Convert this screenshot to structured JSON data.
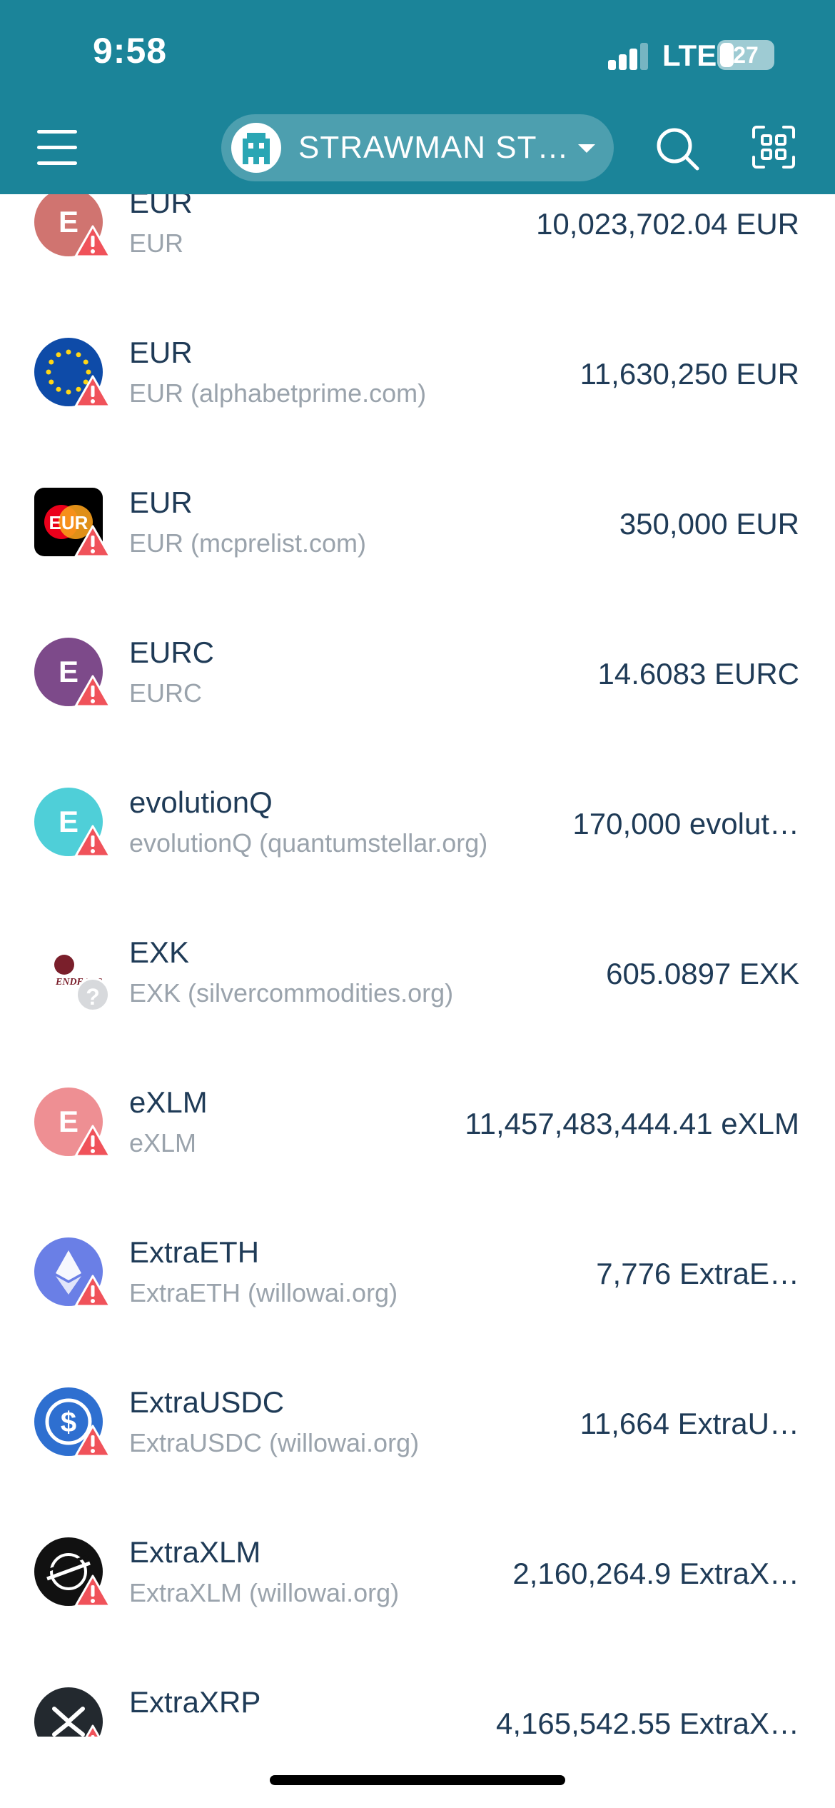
{
  "status_bar": {
    "time": "9:58",
    "network": "LTE",
    "battery": "27",
    "battery_level": 0.27
  },
  "header": {
    "account_name": "STRAWMAN ST…",
    "menu_icon": "menu-icon",
    "search_icon": "search-icon",
    "scan_icon": "qr-scan-icon"
  },
  "colors": {
    "header_bg": "#1b8499",
    "text_primary": "#1f3b57",
    "text_secondary": "#9aa3ac",
    "warning": "#f0525a"
  },
  "assets": [
    {
      "letter": "E",
      "code": "EUR",
      "domain": "EUR",
      "balance": "10,023,702.04 EUR",
      "icon": "letter-avatar",
      "color": "#d07470",
      "flag": "warning"
    },
    {
      "letter": "",
      "code": "EUR",
      "domain": "EUR (alphabetprime.com)",
      "balance": "11,630,250 EUR",
      "icon": "eu-flag-icon",
      "color": "#0e4ba8",
      "flag": "warning"
    },
    {
      "letter": "EUR",
      "code": "EUR",
      "domain": "EUR (mcprelist.com)",
      "balance": "350,000 EUR",
      "icon": "mastercard-eur-icon",
      "color": "#000000",
      "flag": "warning"
    },
    {
      "letter": "E",
      "code": "EURC",
      "domain": "EURC",
      "balance": "14.6083 EURC",
      "icon": "letter-avatar",
      "color": "#7d4a8a",
      "flag": "warning"
    },
    {
      "letter": "E",
      "code": "evolutionQ",
      "domain": "evolutionQ (quantumstellar.org)",
      "balance": "170,000 evolut…",
      "icon": "letter-avatar",
      "color": "#4fcfd8",
      "flag": "warning"
    },
    {
      "letter": "ENDEAVO",
      "code": "EXK",
      "domain": "EXK (silvercommodities.org)",
      "balance": "605.0897 EXK",
      "icon": "endeavour-logo-icon",
      "color": "#ffffff",
      "flag": "unknown"
    },
    {
      "letter": "E",
      "code": "eXLM",
      "domain": "eXLM",
      "balance": "11,457,483,444.41 eXLM",
      "icon": "letter-avatar",
      "color": "#ee8f93",
      "flag": "warning"
    },
    {
      "letter": "",
      "code": "ExtraETH",
      "domain": "ExtraETH (willowai.org)",
      "balance": "7,776 ExtraE…",
      "icon": "ethereum-icon",
      "color": "#6a7fe6",
      "flag": "warning"
    },
    {
      "letter": "",
      "code": "ExtraUSDC",
      "domain": "ExtraUSDC (willowai.org)",
      "balance": "11,664 ExtraU…",
      "icon": "usdc-icon",
      "color": "#2e6fd0",
      "flag": "warning"
    },
    {
      "letter": "",
      "code": "ExtraXLM",
      "domain": "ExtraXLM (willowai.org)",
      "balance": "2,160,264.9 ExtraX…",
      "icon": "stellar-icon",
      "color": "#111111",
      "flag": "warning"
    },
    {
      "letter": "",
      "code": "ExtraXRP",
      "domain": "",
      "balance": "4,165,542.55 ExtraX…",
      "icon": "xrp-icon",
      "color": "#23292f",
      "flag": "warning"
    }
  ]
}
